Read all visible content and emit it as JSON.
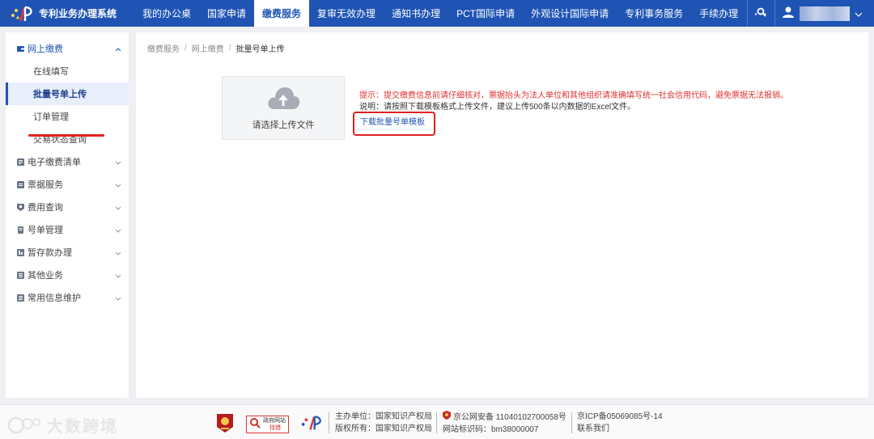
{
  "header": {
    "app_title": "专利业务办理系统",
    "nav": [
      {
        "label": "我的办公桌",
        "active": false
      },
      {
        "label": "国家申请",
        "active": false
      },
      {
        "label": "缴费服务",
        "active": true
      },
      {
        "label": "复审无效办理",
        "active": false
      },
      {
        "label": "通知书办理",
        "active": false
      },
      {
        "label": "PCT国际申请",
        "active": false
      },
      {
        "label": "外观设计国际申请",
        "active": false
      },
      {
        "label": "专利事务服务",
        "active": false
      },
      {
        "label": "手续办理",
        "active": false
      }
    ],
    "more": "···"
  },
  "sidebar": {
    "group_open": "网上缴费",
    "sub_items": [
      "在线填写",
      "批量号单上传",
      "订单管理",
      "交易状态查询"
    ],
    "active_sub": "批量号单上传",
    "groups": [
      "电子缴费清单",
      "票据服务",
      "费用查询",
      "号单管理",
      "暂存款办理",
      "其他业务",
      "常用信息维护"
    ]
  },
  "breadcrumb": [
    "缴费服务",
    "网上缴费",
    "批量号单上传"
  ],
  "upload": {
    "label": "请选择上传文件"
  },
  "tips": {
    "warning": "提示：提交缴费信息前请仔细核对，票据抬头为法人单位和其他组织请准确填写统一社会信用代码，避免票据无法报销。",
    "note": "说明：请按照下载模板格式上传文件，建议上传500条以内数据的Excel文件。",
    "download_link": "下载批量号单模板"
  },
  "footer": {
    "watermark": "大数跨境",
    "gov_badge_line1": "政府网站",
    "gov_badge_line2": "找错",
    "host_label": "主办单位：国家知识产权局",
    "copyright_label": "版权所有：国家知识产权局",
    "police_record": "京公网安备 11040102700058号",
    "site_code": "网站标识码：bm38000007",
    "icp": "京ICP备05069085号-14",
    "contact": "联系我们"
  },
  "colors": {
    "primary": "#1f54b4",
    "warning_text": "#e03030",
    "annotation": "#e02020"
  }
}
